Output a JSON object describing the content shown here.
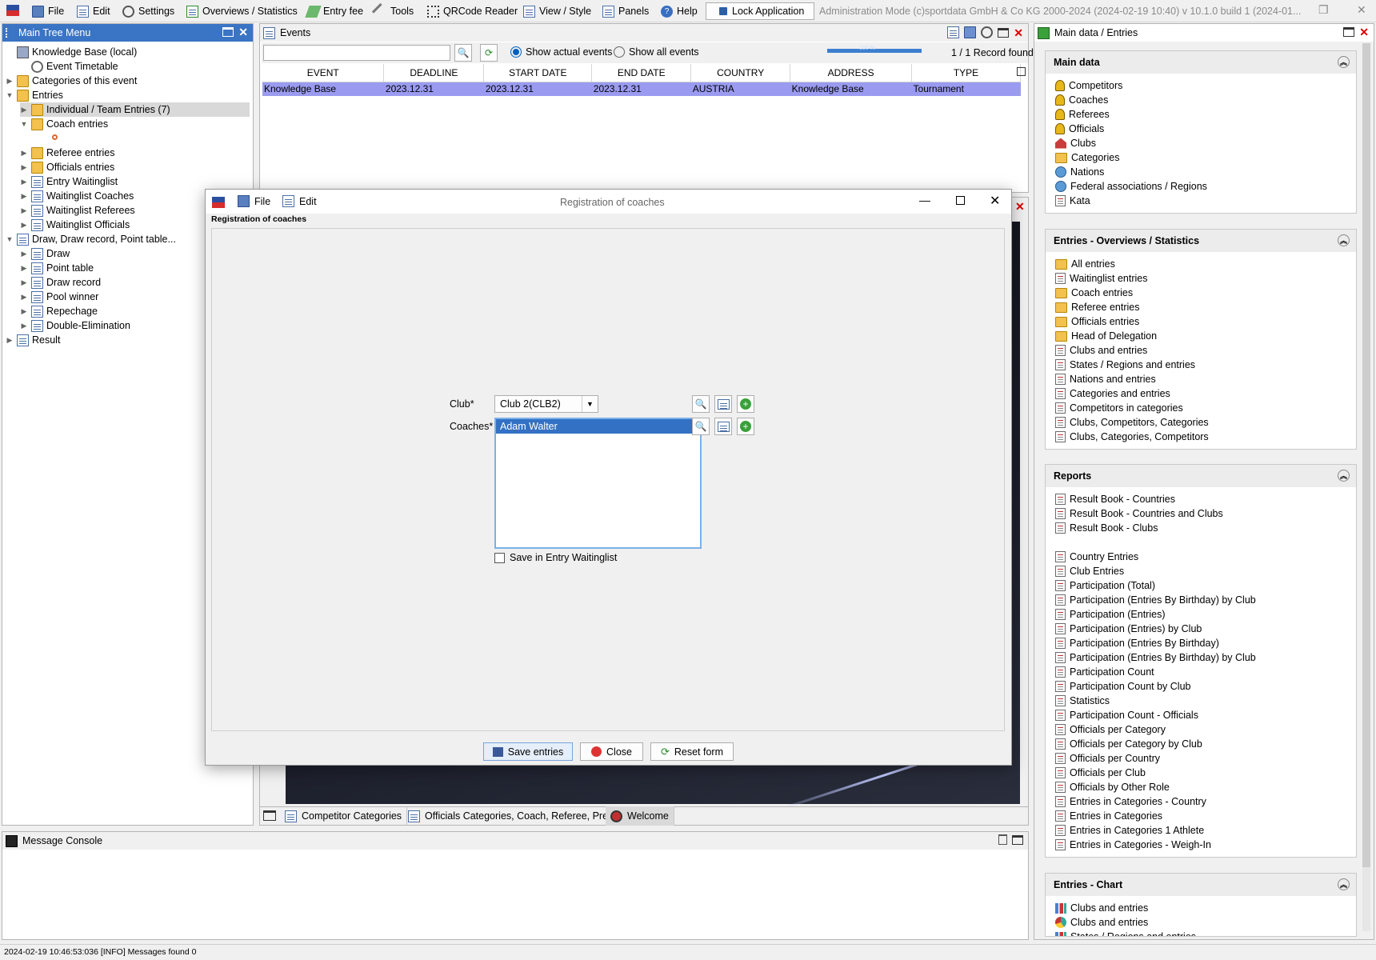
{
  "menubar": {
    "items": [
      "File",
      "Edit",
      "Settings",
      "Overviews / Statistics",
      "Entry fee",
      "Tools",
      "QRCode Reader",
      "View / Style",
      "Panels",
      "Help"
    ],
    "lock_label": "Lock Application",
    "admin_text": "Administration Mode (c)sportdata GmbH & Co KG 2000-2024 (2024-02-19 10:40)  v 10.1.0 build 1 (2024-01..."
  },
  "tree": {
    "title": "Main Tree Menu",
    "items": [
      "Knowledge Base (local)",
      "Event Timetable",
      "Categories of this event",
      "Entries",
      "Individual / Team Entries (7)",
      "Coach entries",
      "Referee entries",
      "Officials entries",
      "Entry Waitinglist",
      "Waitinglist Coaches",
      "Waitinglist Referees",
      "Waitinglist Officials",
      "Draw, Draw record, Point table...",
      "Draw",
      "Point table",
      "Draw record",
      "Pool winner",
      "Repechage",
      "Double-Elimination",
      "Result"
    ]
  },
  "events": {
    "title": "Events",
    "search_value": "",
    "radio_actual": "Show actual events",
    "radio_all": "Show all events",
    "progress_label": "100 %",
    "progress_fraction": 1.0,
    "record_count": "1 / 1 Record found",
    "columns": [
      "EVENT",
      "DEADLINE",
      "START DATE",
      "END DATE",
      "COUNTRY",
      "ADDRESS",
      "TYPE"
    ],
    "row": [
      "Knowledge Base",
      "2023.12.31",
      "2023.12.31",
      "2023.12.31",
      "AUSTRIA",
      "Knowledge Base",
      "Tournament"
    ]
  },
  "tabs": [
    "Competitor Categories",
    "Officials Categories, Coach, Referee, Press",
    "Welcome"
  ],
  "console": {
    "title": "Message Console"
  },
  "status": "2024-02-19 10:46:53:036 [INFO] Messages found 0",
  "side": {
    "title": "Main data / Entries",
    "main_data": {
      "title": "Main data",
      "items": [
        "Competitors",
        "Coaches",
        "Referees",
        "Officials",
        "Clubs",
        "Categories",
        "Nations",
        "Federal associations / Regions",
        "Kata"
      ]
    },
    "overviews": {
      "title": "Entries - Overviews / Statistics",
      "items": [
        "All entries",
        "Waitinglist entries",
        "Coach entries",
        "Referee entries",
        "Officials entries",
        "Head of Delegation",
        "Clubs and entries",
        "States / Regions and entries",
        "Nations and entries",
        "Categories and entries",
        "Competitors in categories",
        "Clubs, Competitors, Categories",
        "Clubs, Categories, Competitors"
      ]
    },
    "reports": {
      "title": "Reports",
      "items": [
        "Result Book - Countries",
        "Result Book - Countries and Clubs",
        "Result Book - Clubs",
        "Country Entries",
        "Club Entries",
        "Participation (Total)",
        "Participation (Entries By Birthday) by Club",
        "Participation (Entries)",
        "Participation (Entries) by Club",
        "Participation (Entries By Birthday)",
        "Participation (Entries By Birthday) by Club",
        "Participation Count",
        "Participation Count by Club",
        "Statistics",
        "Participation Count - Officials",
        "Officials per Category",
        "Officials per Category by Club",
        "Officials per Country",
        "Officials per Club",
        "Officials by Other Role",
        "Entries in Categories - Country",
        "Entries in Categories",
        "Entries in Categories 1 Athlete",
        "Entries in Categories - Weigh-In"
      ]
    },
    "chart": {
      "title": "Entries - Chart",
      "items": [
        "Clubs and entries",
        "Clubs and entries",
        "States / Regions and entries"
      ]
    }
  },
  "dialog": {
    "title": "Registration of coaches",
    "menu_file": "File",
    "menu_edit": "Edit",
    "group_label": "Registration of coaches",
    "club_label": "Club*",
    "club_value": "Club 2(CLB2)",
    "coaches_label": "Coaches*",
    "coaches": [
      "Adam Walter"
    ],
    "waitinglist_label": "Save in Entry Waitinglist",
    "save_label": "Save entries",
    "close_label": "Close",
    "reset_label": "Reset form"
  }
}
